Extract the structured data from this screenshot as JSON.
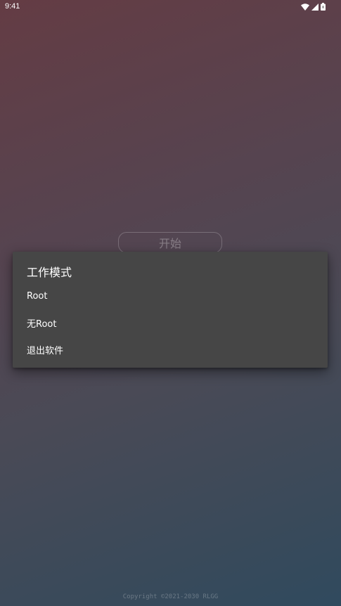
{
  "status_bar": {
    "time": "9:41",
    "icons": [
      "wifi-icon",
      "signal-icon",
      "battery-icon"
    ]
  },
  "main": {
    "start_button_label": "开始"
  },
  "dialog": {
    "title": "工作模式",
    "items": [
      {
        "label": "Root"
      },
      {
        "label": "无Root"
      },
      {
        "label": "退出软件"
      }
    ]
  },
  "footer": {
    "copyright": "Copyright ©2021-2030 RLGG"
  },
  "colors": {
    "dialog_background": "#464646",
    "gradient_top": "#643c44",
    "gradient_bottom": "#304a5e"
  }
}
